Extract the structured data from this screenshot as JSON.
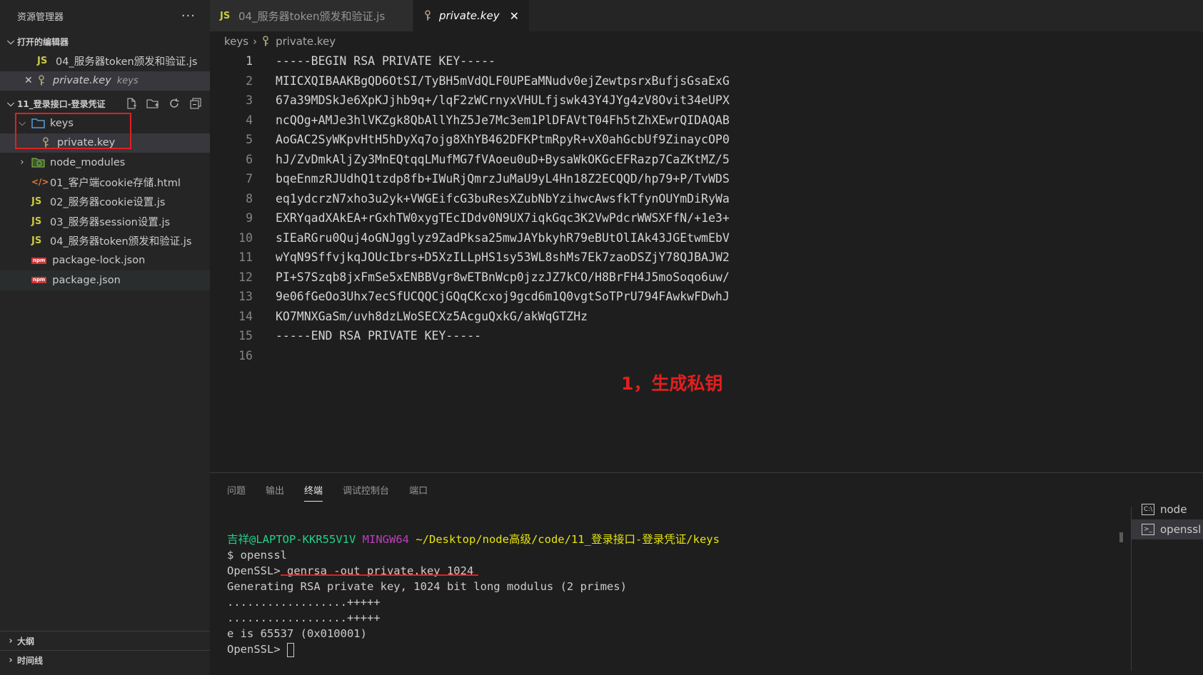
{
  "sidebar": {
    "title": "资源管理器",
    "more": "···",
    "open_editors": {
      "title": "打开的编辑器",
      "items": [
        {
          "icon": "JS",
          "label": "04_服务器token颁发和验证.js"
        },
        {
          "label": "private.key",
          "folder": "keys"
        }
      ]
    },
    "project": {
      "title": "11_登录接口-登录凭证",
      "items": [
        {
          "label": "keys"
        },
        {
          "label": "private.key"
        },
        {
          "label": "node_modules"
        },
        {
          "label": "01_客户端cookie存储.html"
        },
        {
          "icon": "JS",
          "label": "02_服务器cookie设置.js"
        },
        {
          "icon": "JS",
          "label": "03_服务器session设置.js"
        },
        {
          "icon": "JS",
          "label": "04_服务器token颁发和验证.js"
        },
        {
          "icon": "npm",
          "label": "package-lock.json"
        },
        {
          "icon": "npm",
          "label": "package.json"
        }
      ]
    },
    "outline": "大纲",
    "timeline": "时间线"
  },
  "tabs": [
    {
      "icon": "JS",
      "label": "04_服务器token颁发和验证.js"
    },
    {
      "label": "private.key",
      "close": "✕"
    }
  ],
  "breadcrumb": {
    "folder": "keys",
    "file": "private.key"
  },
  "code": {
    "lines": [
      {
        "n": "1",
        "t": "-----BEGIN RSA PRIVATE KEY-----"
      },
      {
        "n": "2",
        "t": "MIICXQIBAAKBgQD6OtSI/TyBH5mVdQLF0UPEaMNudv0ejZewtpsrxBufjsGsaExG"
      },
      {
        "n": "3",
        "t": "67a39MDSkJe6XpKJjhb9q+/lqF2zWCrnyxVHULfjswk43Y4JYg4zV8Ovit34eUPX"
      },
      {
        "n": "4",
        "t": "ncQOg+AMJe3hlVKZgk8QbAllYhZ5Je7Mc3em1PlDFAVtT04Fh5tZhXEwrQIDAQAB"
      },
      {
        "n": "5",
        "t": "AoGAC2SyWKpvHtH5hDyXq7ojg8XhYB462DFKPtmRpyR+vX0ahGcbUf9ZinaycOP0"
      },
      {
        "n": "6",
        "t": "hJ/ZvDmkAljZy3MnEQtqqLMufMG7fVAoeu0uD+BysaWkOKGcEFRazp7CaZKtMZ/5"
      },
      {
        "n": "7",
        "t": "bqeEnmzRJUdhQ1tzdp8fb+IWuRjQmrzJuMaU9yL4Hn18Z2ECQQD/hp79+P/TvWDS"
      },
      {
        "n": "8",
        "t": "eq1ydcrzN7xho3u2yk+VWGEifcG3buResXZubNbYzihwcAwsfkTfynOUYmDiRyWa"
      },
      {
        "n": "9",
        "t": "EXRYqadXAkEA+rGxhTW0xygTEcIDdv0N9UX7iqkGqc3K2VwPdcrWWSXFfN/+1e3+"
      },
      {
        "n": "10",
        "t": "sIEaRGru0Quj4oGNJgglyz9ZadPksa25mwJAYbkyhR79eBUtOlIAk43JGEtwmEbV"
      },
      {
        "n": "11",
        "t": "wYqN9SffvjkqJOUcIbrs+D5XzILLpHS1sy53WL8shMs7Ek7zaoDSZjY78QJBAJW2"
      },
      {
        "n": "12",
        "t": "PI+S7Szqb8jxFmSe5xENBBVgr8wETBnWcp0jzzJZ7kCO/H8BrFH4J5moSoqo6uw/"
      },
      {
        "n": "13",
        "t": "9e06fGeOo3Uhx7ecSfUCQQCjGQqCKcxoj9gcd6m1Q0vgtSoTPrU794FAwkwFDwhJ"
      },
      {
        "n": "14",
        "t": "KO7MNXGaSm/uvh8dzLWoSECXz5AcguQxkG/akWqGTZHz"
      },
      {
        "n": "15",
        "t": "-----END RSA PRIVATE KEY-----"
      },
      {
        "n": "16",
        "t": ""
      }
    ],
    "annotation": "1，生成私钥"
  },
  "panel": {
    "tabs": [
      "问题",
      "输出",
      "终端",
      "调试控制台",
      "端口"
    ],
    "terminal": {
      "user": "吉祥@LAPTOP-KKR55V1V",
      "env": "MINGW64",
      "path": "~/Desktop/node高级/code/11_登录接口-登录凭证/keys",
      "lines": [
        "$ openssl",
        "OpenSSL> genrsa -out private.key 1024",
        "Generating RSA private key, 1024 bit long modulus (2 primes)",
        "..................+++++",
        "..................+++++",
        "e is 65537 (0x010001)",
        "OpenSSL> "
      ]
    },
    "terminal_list": [
      {
        "icon": "cmd-icon",
        "label": "node"
      },
      {
        "icon": "terminal-icon",
        "label": "openssl"
      }
    ]
  },
  "colors": {
    "annotation": "#e02020",
    "js": "#cbcb41",
    "prompt_user": "#23d18b",
    "prompt_env": "#bc3fbc",
    "prompt_path": "#e5e510"
  }
}
